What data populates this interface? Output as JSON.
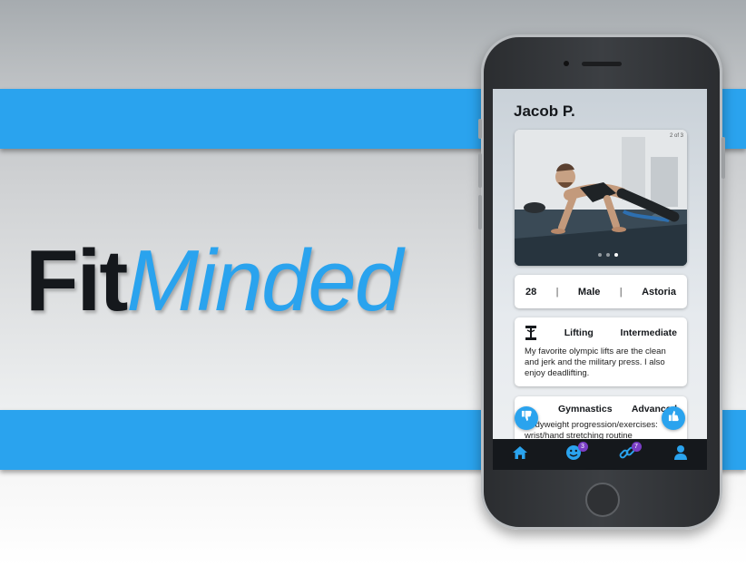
{
  "brand": {
    "fit": "Fit",
    "minded": "Minded",
    "accent": "#2aa3ee",
    "dark": "#15181c"
  },
  "profile": {
    "name": "Jacob P.",
    "photo_counter": "2 of 3",
    "photo_pages": 3,
    "photo_current": 2,
    "age": "28",
    "sep": "|",
    "gender": "Male",
    "location": "Astoria"
  },
  "activities": [
    {
      "icon": "dumbbell-icon",
      "name": "Lifting",
      "level": "Intermediate",
      "description": "My favorite olympic lifts are the clean and jerk and the military press. I also enjoy deadlifting."
    },
    {
      "icon": "gymnastics-icon",
      "name": "Gymnastics",
      "level": "Advanced",
      "description": "Bodyweight progression/exercises: wrist/hand stretching routine"
    }
  ],
  "actions": {
    "dislike_icon": "thumbs-down-icon",
    "like_icon": "thumbs-up-icon"
  },
  "nav": [
    {
      "icon": "home-icon",
      "badge": ""
    },
    {
      "icon": "smiley-icon",
      "badge": "3"
    },
    {
      "icon": "link-icon",
      "badge": "7"
    },
    {
      "icon": "user-icon",
      "badge": ""
    }
  ]
}
